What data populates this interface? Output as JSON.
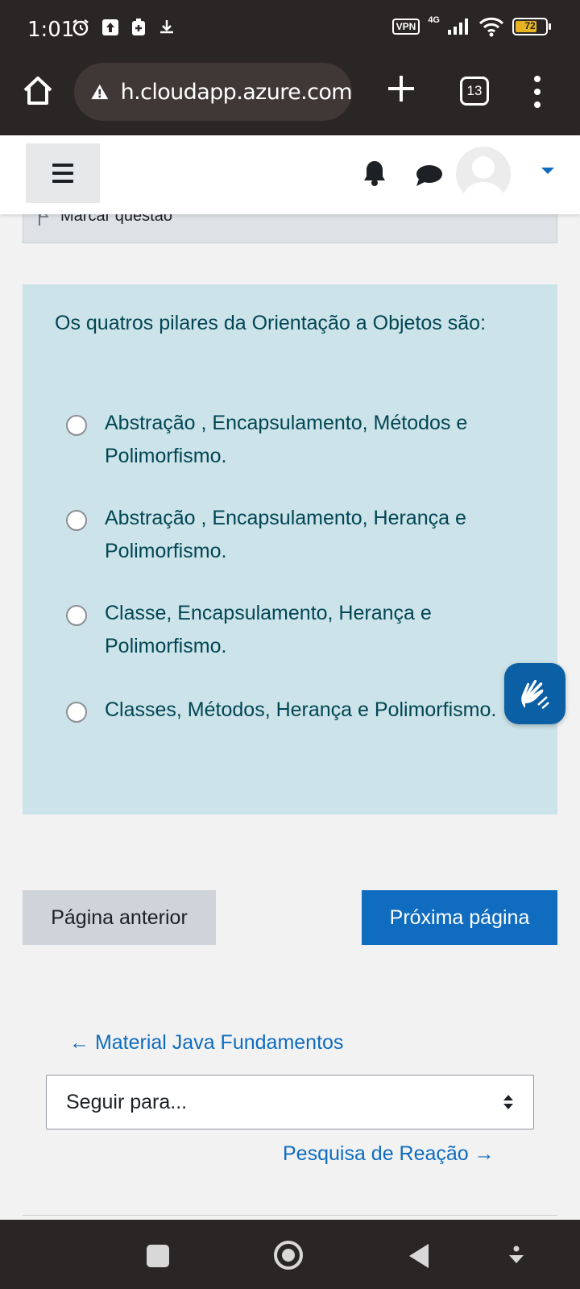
{
  "status_bar": {
    "time": "1:01",
    "vpn": "VPN",
    "network": "4G",
    "battery": "72",
    "icons": [
      "alarm-icon",
      "upload-icon",
      "battery-saver-icon",
      "download-icon",
      "signal-icon",
      "wifi-icon"
    ]
  },
  "browser": {
    "url": "h.cloudapp.azure.com",
    "tab_count": "13",
    "icons": [
      "home-icon",
      "warning-icon",
      "plus-icon",
      "more-vert-icon"
    ]
  },
  "navbar": {
    "icons": [
      "menu-icon",
      "bell-icon",
      "chat-icon",
      "avatar-icon",
      "caret-down-icon"
    ]
  },
  "question": {
    "flag_label": "Marcar questão",
    "text": "Os quatros pilares da Orientação a Objetos são:",
    "options": [
      "Abstração , Encapsulamento,  Métodos e Polimorfismo.",
      "Abstração , Encapsulamento,  Herança e Polimorfismo.",
      "Classe, Encapsulamento,  Herança e Polimorfismo.",
      "Classes, Métodos,  Herança e Polimorfismo."
    ],
    "selected_index": null
  },
  "navigation": {
    "prev_button": "Página anterior",
    "next_button": "Próxima página"
  },
  "activity_nav": {
    "prev_link": "← Material Java Fundamentos",
    "jump_placeholder": "Seguir para...",
    "next_link": "Pesquisa de Reação →"
  },
  "colors": {
    "primary": "#0f6cbf",
    "question_bg": "#cbe3e9",
    "question_text": "#024654"
  }
}
